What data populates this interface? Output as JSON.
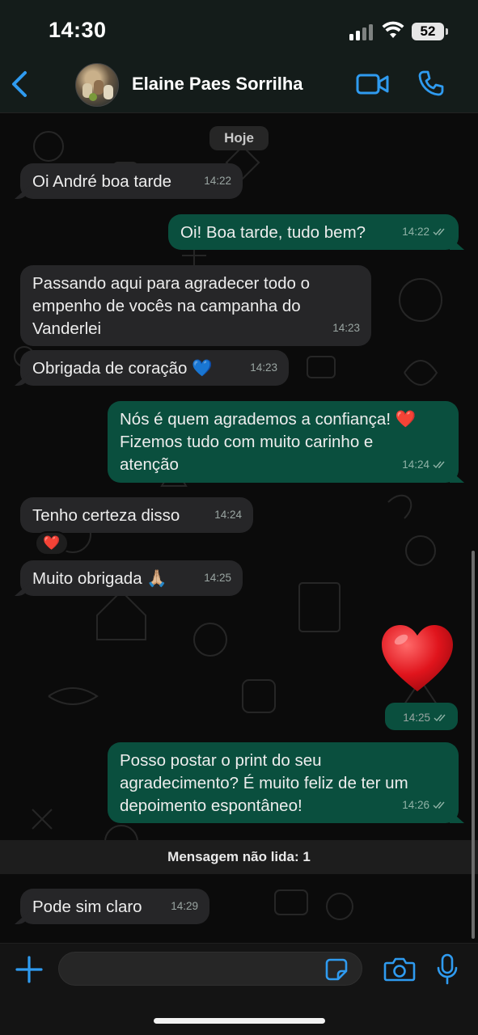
{
  "status_bar": {
    "time": "14:30",
    "battery": "52"
  },
  "header": {
    "contact_name": "Elaine Paes Sorrilha"
  },
  "chat": {
    "date_label": "Hoje",
    "messages": [
      {
        "dir": "in",
        "text": "Oi André boa tarde",
        "time": "14:22"
      },
      {
        "dir": "out",
        "text": "Oi! Boa tarde, tudo bem?",
        "time": "14:22"
      },
      {
        "dir": "in",
        "text": "Passando aqui para agradecer todo o empenho de vocês na campanha do Vanderlei",
        "time": "14:23"
      },
      {
        "dir": "in",
        "text": "Obrigada de coração 💙",
        "time": "14:23"
      },
      {
        "dir": "out",
        "text": "Nós é quem agrademos a confiança! ❤️ Fizemos tudo com muito carinho e atenção",
        "time": "14:24"
      },
      {
        "dir": "in",
        "text": "Tenho certeza disso",
        "time": "14:24",
        "reaction": "❤️"
      },
      {
        "dir": "in",
        "text": "Muito obrigada 🙏🏼",
        "time": "14:25"
      },
      {
        "dir": "out",
        "text": "❤️",
        "time": "14:25"
      },
      {
        "dir": "out",
        "text": "Posso postar o print do seu agradecimento? É muito feliz de ter um depoimento espontâneo!",
        "time": "14:26"
      },
      {
        "dir": "in",
        "text": "Pode sim claro",
        "time": "14:29"
      }
    ],
    "unread_label": "Mensagem não lida: 1"
  },
  "input": {
    "value": ""
  },
  "colors": {
    "accent": "#2f9bf0",
    "incoming_bubble": "#262628",
    "outgoing_bubble": "#0a4f3e",
    "background": "#0b0b0b"
  },
  "icons": [
    "back-icon",
    "video-call-icon",
    "phone-icon",
    "plus-icon",
    "sticker-icon",
    "camera-icon",
    "microphone-icon",
    "double-check-icon",
    "heart-icon"
  ]
}
